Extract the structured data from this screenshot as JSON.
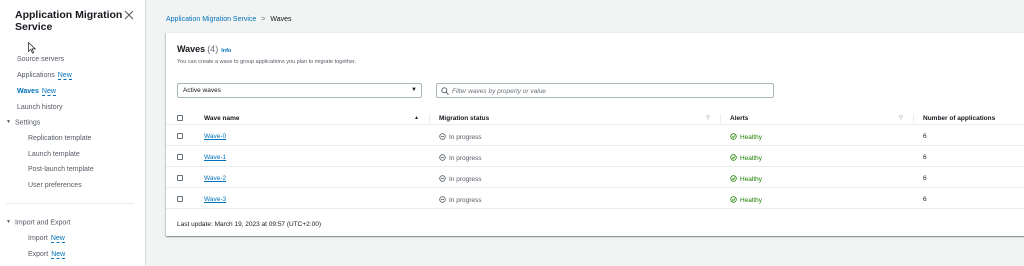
{
  "sidebar": {
    "title": "Application Migration Service",
    "items": [
      {
        "label": "Source servers"
      },
      {
        "label": "Applications",
        "badge": "New"
      },
      {
        "label": "Waves",
        "badge": "New",
        "active": true
      },
      {
        "label": "Launch history"
      }
    ],
    "settings": {
      "label": "Settings",
      "items": [
        {
          "label": "Replication template"
        },
        {
          "label": "Launch template"
        },
        {
          "label": "Post-launch template"
        },
        {
          "label": "User preferences"
        }
      ]
    },
    "import_export": {
      "label": "Import and Export",
      "items": [
        {
          "label": "Import",
          "badge": "New"
        },
        {
          "label": "Export",
          "badge": "New"
        }
      ]
    }
  },
  "breadcrumb": {
    "items": [
      "Application Migration Service",
      "Waves"
    ]
  },
  "panel": {
    "title": "Waves",
    "count": "(4)",
    "info": "Info",
    "description": "You can create a wave to group applications you plan to migrate together.",
    "filter_select": {
      "value": "Active waves"
    },
    "search": {
      "placeholder": "Filter waves by property or value"
    }
  },
  "table": {
    "columns": [
      "Wave name",
      "Migration status",
      "Alerts",
      "Number of applications"
    ],
    "rows": [
      {
        "name": "Wave-0",
        "status": "In progress",
        "alert": "Healthy",
        "apps": "6"
      },
      {
        "name": "Wave-1",
        "status": "In progress",
        "alert": "Healthy",
        "apps": "6"
      },
      {
        "name": "Wave-2",
        "status": "In progress",
        "alert": "Healthy",
        "apps": "6"
      },
      {
        "name": "Wave-3",
        "status": "In progress",
        "alert": "Healthy",
        "apps": "6"
      }
    ],
    "last_update": "Last update: March 19, 2023 at 09:57 (UTC+2:00)"
  },
  "colors": {
    "link": "#0073bb",
    "healthy": "#1d8102",
    "text": "#16191f",
    "muted": "#545b64"
  },
  "icons": {
    "close": "close-icon",
    "search": "search-icon",
    "status": "in-progress-icon",
    "alert": "check-circle-icon"
  }
}
